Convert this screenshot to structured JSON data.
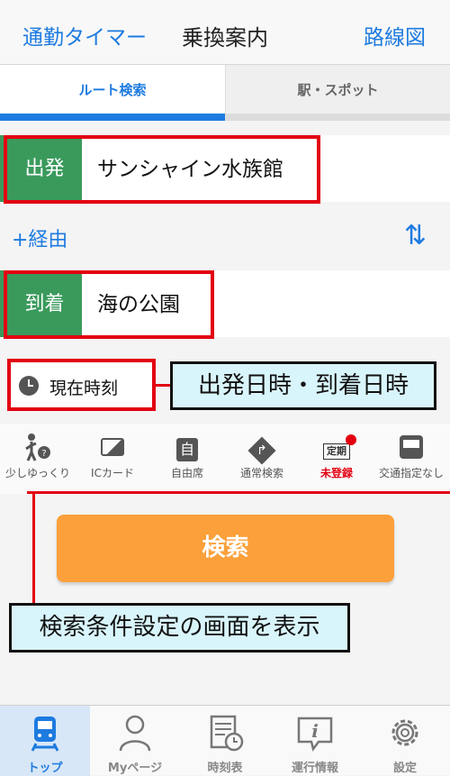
{
  "nav": {
    "left": "通勤タイマー",
    "title": "乗換案内",
    "right": "路線図"
  },
  "tabs": {
    "route": "ルート検索",
    "station": "駅・スポット"
  },
  "departure": {
    "tag": "出発",
    "name": "サンシャイン水族館"
  },
  "via": "+経由",
  "swap_icon": "⇅",
  "arrival": {
    "tag": "到着",
    "name": "海の公園"
  },
  "time": {
    "label": "現在時刻"
  },
  "callouts": {
    "time": "出発日時・到着日時",
    "options": "検索条件設定の画面を表示"
  },
  "options": [
    {
      "label": "少しゆっくり",
      "icon": "walker-icon"
    },
    {
      "label": "ICカード",
      "icon": "ic-card-icon"
    },
    {
      "label": "自由席",
      "icon": "seat-icon",
      "glyph": "自"
    },
    {
      "label": "通常検索",
      "icon": "route-diamond-icon",
      "glyph": "↱"
    },
    {
      "label": "未登録",
      "icon": "commuter-pass-icon",
      "glyph": "定期"
    },
    {
      "label": "交通指定なし",
      "icon": "bus-icon"
    }
  ],
  "search_button": "検索",
  "tabbar": [
    {
      "label": "トップ",
      "icon": "train-icon"
    },
    {
      "label": "Myページ",
      "icon": "person-icon"
    },
    {
      "label": "時刻表",
      "icon": "timetable-icon"
    },
    {
      "label": "運行情報",
      "icon": "info-icon"
    },
    {
      "label": "設定",
      "icon": "gear-icon"
    }
  ],
  "colors": {
    "accent": "#1e7be0",
    "green": "#3a9a5c",
    "highlight_red": "#e20010",
    "search_orange": "#fba03a",
    "callout_bg": "#d9f5fc"
  }
}
